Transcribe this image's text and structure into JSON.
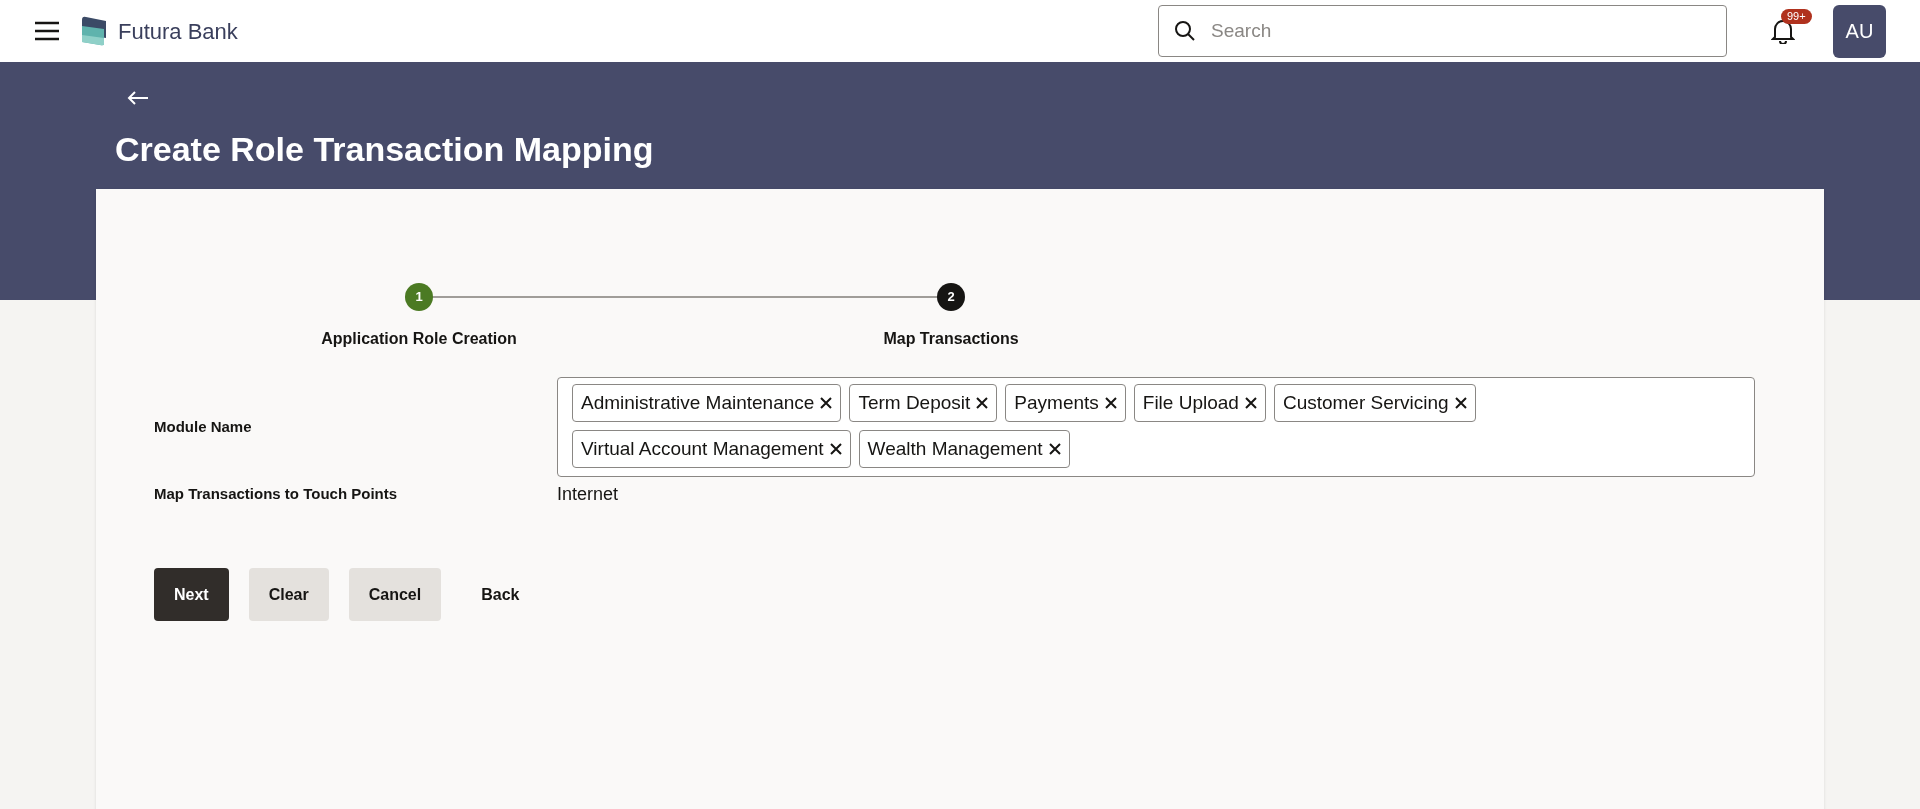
{
  "header": {
    "brand": "Futura Bank",
    "search": {
      "placeholder": "Search"
    },
    "notifications": {
      "badge": "99+"
    },
    "avatar": "AU"
  },
  "page": {
    "title": "Create Role Transaction Mapping"
  },
  "steps": [
    {
      "number": "1",
      "label": "Application Role Creation",
      "completed": true
    },
    {
      "number": "2",
      "label": "Map Transactions",
      "completed": false
    }
  ],
  "form": {
    "module_name": {
      "label": "Module Name",
      "chips": [
        "Administrative Maintenance",
        "Term Deposit",
        "Payments",
        "File Upload",
        "Customer Servicing",
        "Virtual Account Management",
        "Wealth Management"
      ]
    },
    "touch_points": {
      "label": "Map Transactions to Touch Points",
      "value": "Internet"
    }
  },
  "buttons": [
    {
      "label": "Next",
      "kind": "primary"
    },
    {
      "label": "Clear",
      "kind": "secondary"
    },
    {
      "label": "Cancel",
      "kind": "secondary"
    },
    {
      "label": "Back",
      "kind": "link"
    }
  ]
}
